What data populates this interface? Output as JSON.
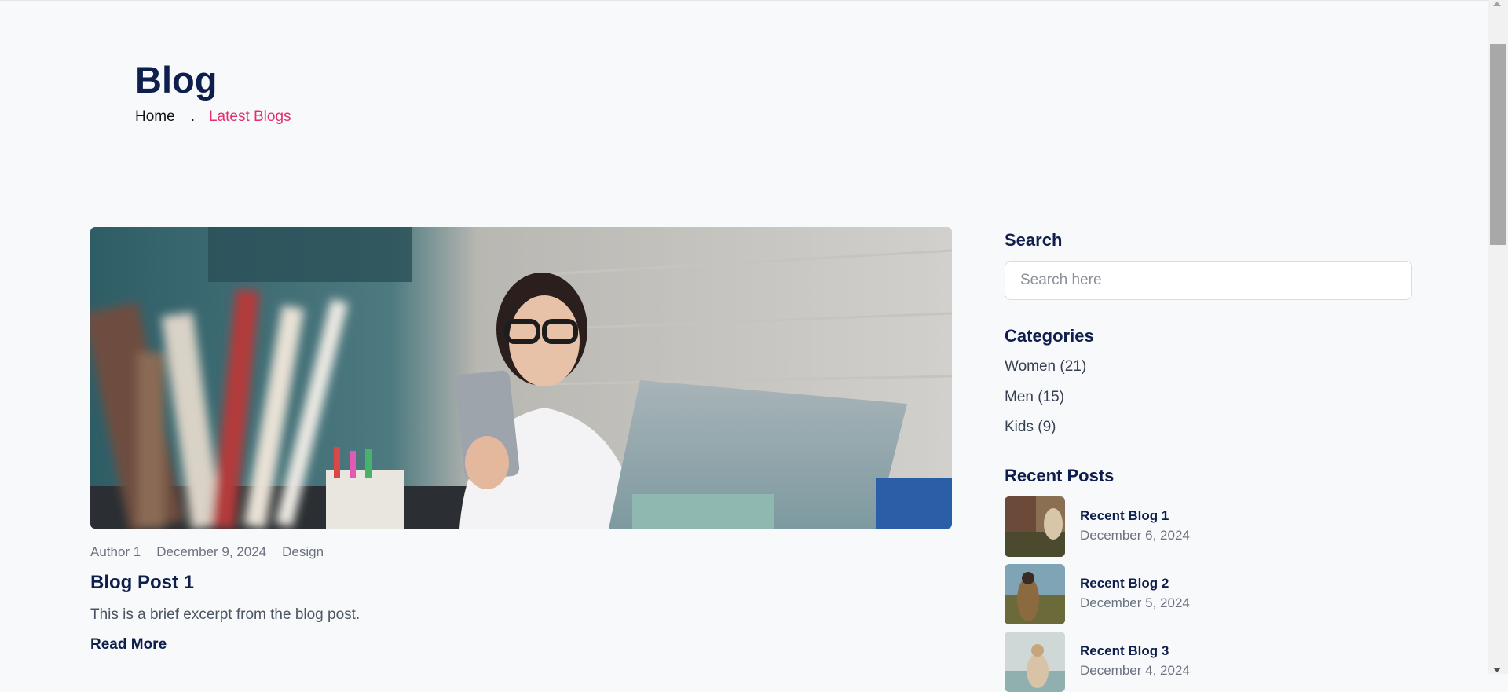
{
  "header": {
    "title": "Blog",
    "breadcrumb": {
      "home": "Home",
      "separator": ".",
      "current": "Latest Blogs"
    }
  },
  "post": {
    "author": "Author 1",
    "date": "December 9, 2024",
    "category": "Design",
    "title": "Blog Post 1",
    "excerpt": "This is a brief excerpt from the blog post.",
    "read_more": "Read More"
  },
  "sidebar": {
    "search": {
      "heading": "Search",
      "placeholder": "Search here",
      "value": ""
    },
    "categories": {
      "heading": "Categories",
      "items": [
        {
          "label": "Women (21)"
        },
        {
          "label": "Men (15)"
        },
        {
          "label": "Kids (9)"
        }
      ]
    },
    "recent_posts": {
      "heading": "Recent Posts",
      "items": [
        {
          "title": "Recent Blog 1",
          "date": "December 6, 2024"
        },
        {
          "title": "Recent Blog 2",
          "date": "December 5, 2024"
        },
        {
          "title": "Recent Blog 3",
          "date": "December 4, 2024"
        }
      ]
    }
  },
  "colors": {
    "heading": "#0f1f4d",
    "accent": "#e52e71",
    "background": "#f8f9fb",
    "muted": "#6b7280"
  }
}
